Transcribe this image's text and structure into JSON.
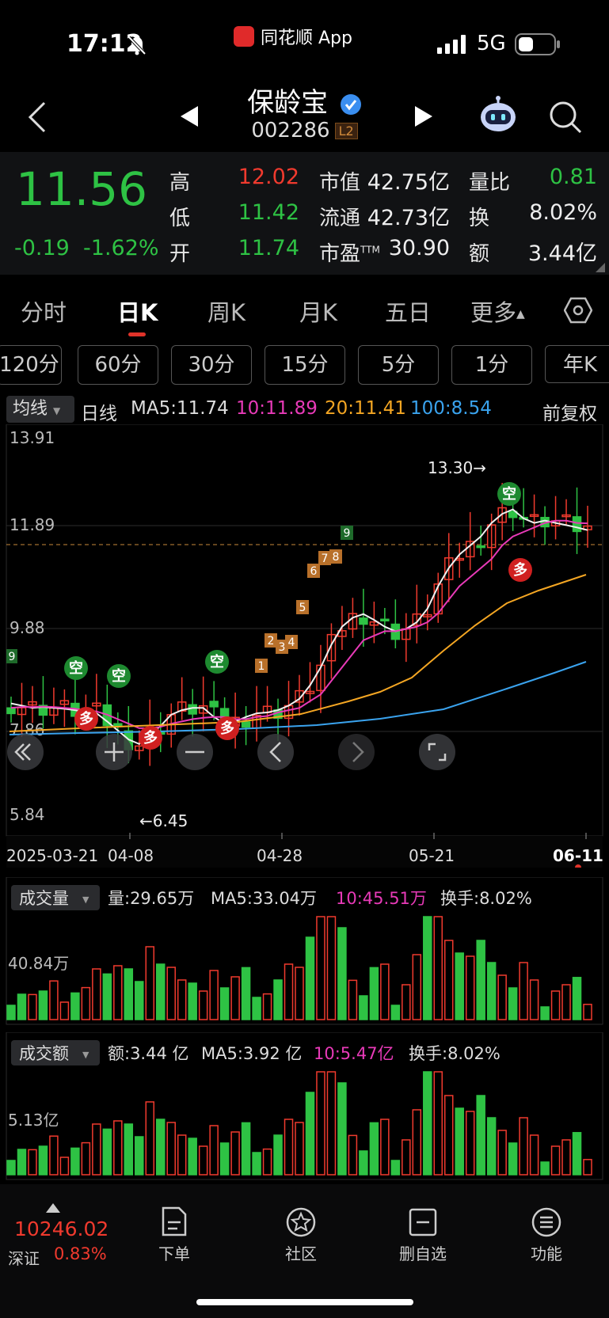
{
  "status_bar": {
    "time": "17:12",
    "app_label": "同花顺 App",
    "network": "5G"
  },
  "header": {
    "stock_name": "保龄宝",
    "stock_code": "002286",
    "level_badge": "L2"
  },
  "quote": {
    "price": "11.56",
    "change": "-0.19",
    "change_pct": "-1.62%",
    "high_label": "高",
    "high": "12.02",
    "low_label": "低",
    "low": "11.42",
    "open_label": "开",
    "open": "11.74",
    "mktcap_label": "市值",
    "mktcap": "42.75亿",
    "float_label": "流通",
    "float": "42.73亿",
    "pe_label": "市盈",
    "pe_sup": "TTM",
    "pe": "30.90",
    "volratio_label": "量比",
    "volratio": "0.81",
    "turnover_label": "换",
    "turnover": "8.02%",
    "amount_label": "额",
    "amount": "3.44亿"
  },
  "period_tabs": [
    {
      "label": "分时"
    },
    {
      "label": "日K"
    },
    {
      "label": "周K"
    },
    {
      "label": "月K"
    },
    {
      "label": "五日"
    },
    {
      "label": "更多"
    }
  ],
  "intervals": [
    {
      "label": "120分"
    },
    {
      "label": "60分"
    },
    {
      "label": "30分"
    },
    {
      "label": "15分"
    },
    {
      "label": "5分"
    },
    {
      "label": "1分"
    },
    {
      "label": "年K"
    }
  ],
  "ma_bar": {
    "indicator": "均线",
    "line_type": "日线",
    "ma5": "MA5:11.74",
    "ma10": "10:11.89",
    "ma20": "20:11.41",
    "ma100": "100:8.54",
    "adjust": "前复权"
  },
  "kline": {
    "y_labels": [
      "13.91",
      "11.89",
      "9.88",
      "7.86",
      "5.84"
    ],
    "max_marker": "13.30→",
    "min_marker": "←6.45",
    "dates": [
      "2025-03-21",
      "04-08",
      "04-28",
      "05-21",
      "06-11"
    ],
    "signal_buy": "多",
    "signal_sell": "空",
    "td_counts": [
      "1",
      "2",
      "3",
      "4",
      "5",
      "6",
      "7",
      "8",
      "9"
    ]
  },
  "volume": {
    "selector": "成交量",
    "vol": "量:29.65万",
    "ma5": "MA5:33.04万",
    "ma10": "10:45.51万",
    "turnover": "换手:8.02%",
    "y_label": "40.84万"
  },
  "amount": {
    "selector": "成交额",
    "amt": "额:3.44 亿",
    "ma5": "MA5:3.92 亿",
    "ma10": "10:5.47亿",
    "turnover": "换手:8.02%",
    "y_label": "5.13亿"
  },
  "bottom_bar": {
    "index_value": "10246.02",
    "index_name": "深证",
    "index_pct": "0.83%",
    "items": [
      {
        "label": "下单"
      },
      {
        "label": "社区"
      },
      {
        "label": "删自选"
      },
      {
        "label": "功能"
      }
    ]
  },
  "colors": {
    "up": "#f03a2e",
    "down": "#2ec244",
    "ma5": "#f0f0f0",
    "ma10": "#e83ab8",
    "ma20": "#f4a623",
    "ma100": "#3aa3ee"
  },
  "chart_data": {
    "type": "candlestick",
    "ylim": [
      5.84,
      13.91
    ],
    "series": [
      {
        "name": "MA5",
        "values": [
          7.9,
          7.85,
          7.8,
          7.82,
          7.8,
          7.78,
          7.75,
          7.7,
          7.68,
          7.5,
          7.3,
          7.1,
          7.0,
          7.2,
          7.4,
          7.65,
          7.75,
          7.8,
          7.8,
          7.6,
          7.45,
          7.5,
          7.6,
          7.68,
          7.7,
          7.75,
          7.85,
          8.0,
          8.3,
          8.7,
          9.2,
          9.6,
          9.8,
          9.88,
          9.75,
          9.6,
          9.5,
          9.55,
          9.7,
          10.0,
          10.5,
          10.9,
          11.2,
          11.4,
          11.6,
          11.9,
          12.1,
          12.2,
          12.0,
          11.9,
          11.95,
          11.9,
          11.85,
          11.8,
          11.74
        ]
      },
      {
        "name": "MA10",
        "values": [
          7.8,
          7.82,
          7.82,
          7.83,
          7.82,
          7.8,
          7.78,
          7.75,
          7.72,
          7.65,
          7.55,
          7.45,
          7.35,
          7.35,
          7.38,
          7.45,
          7.5,
          7.55,
          7.58,
          7.6,
          7.6,
          7.55,
          7.55,
          7.6,
          7.62,
          7.7,
          7.75,
          7.8,
          7.95,
          8.1,
          8.4,
          8.7,
          9.0,
          9.3,
          9.4,
          9.5,
          9.5,
          9.55,
          9.6,
          9.7,
          9.9,
          10.2,
          10.5,
          10.7,
          10.9,
          11.1,
          11.4,
          11.6,
          11.7,
          11.8,
          11.9,
          11.95,
          11.95,
          11.9,
          11.89
        ]
      }
    ]
  }
}
